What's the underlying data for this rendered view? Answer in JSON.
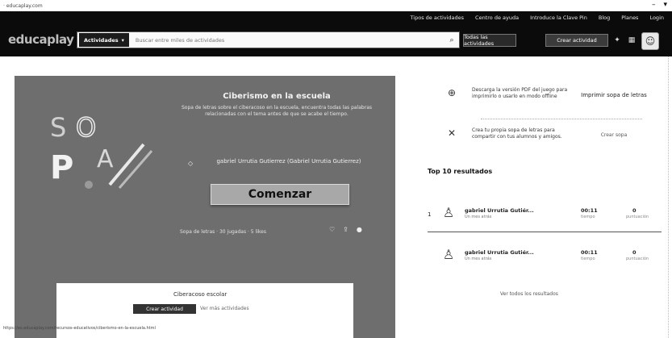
{
  "window": {
    "title": "· educaplay.com",
    "controls": [
      "–",
      "▾"
    ]
  },
  "nav": {
    "links": [
      "Tipos de actividades",
      "Centro de ayuda",
      "Introduce la Clave Pin",
      "Blog",
      "Planes",
      "Login"
    ],
    "logo": "educaplay",
    "search": {
      "category": "Actividades",
      "placeholder": "Buscar entre miles de actividades",
      "button": "Todas las actividades"
    },
    "create_button": "Crear actividad"
  },
  "hero": {
    "art_text": "SOPA",
    "title": "Ciberismo en la escuela",
    "description": "Sopa de letras sobre el ciberacoso en la escuela, encuentra todas las palabras relacionadas con el tema antes de que se acabe el tiempo.",
    "author": "gabriel Urrutia Gutierrez (Gabriel Urrutia Gutierrez)",
    "start_button": "Comenzar",
    "meta": "Sopa de letras · 30 jugadas · 5 likes",
    "card": {
      "title": "Ciberacoso escolar",
      "button": "Crear actividad",
      "link": "Ver más actividades"
    }
  },
  "side_info": [
    {
      "icon": "download-icon",
      "text": "Descarga la versión PDF del juego para imprimirlo o usarlo en modo offline",
      "link": "Imprimir sopa de letras"
    },
    {
      "icon": "close-icon",
      "text": "Crea tu propia sopa de letras para compartir con tus alumnos y amigos.",
      "link": "Crear sopa"
    }
  ],
  "results": {
    "heading": "Top 10 resultados",
    "rows": [
      {
        "rank": "1",
        "name": "gabriel Urrutia Gutiér...",
        "sub": "Un mes atrás",
        "time": "00:11",
        "time_sub": "tiempo",
        "score": "0",
        "score_sub": "puntuación"
      },
      {
        "rank": "",
        "name": "gabriel Urrutia Gutiér...",
        "sub": "Un mes atrás",
        "time": "00:11",
        "time_sub": "tiempo",
        "score": "0",
        "score_sub": "puntuación"
      }
    ],
    "see_all": "Ver todos los resultados"
  },
  "status_url": "https://es.educaplay.com/recursos-educativos/ciberismo-en-la-escuela.html"
}
